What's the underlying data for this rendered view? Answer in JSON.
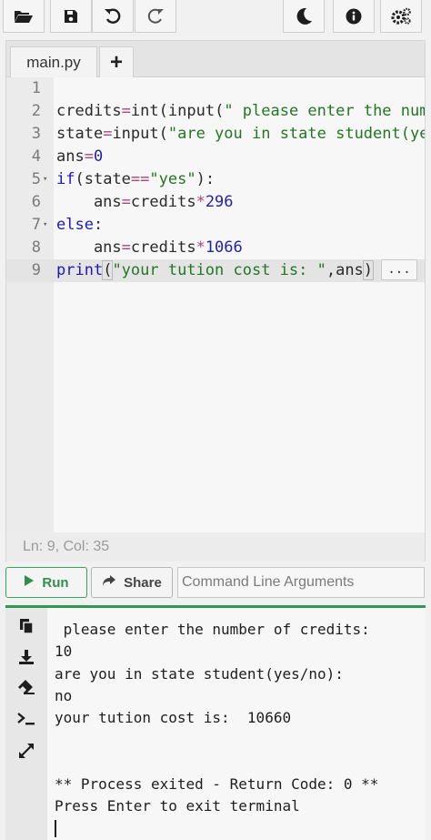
{
  "editor": {
    "tab_label": "main.py",
    "add_tab_label": "+",
    "lines": [
      {
        "n": "1",
        "tokens": []
      },
      {
        "n": "2",
        "tokens": [
          {
            "t": "credits",
            "c": "plain"
          },
          {
            "t": "=",
            "c": "op"
          },
          {
            "t": "int",
            "c": "plain"
          },
          {
            "t": "(",
            "c": "plain"
          },
          {
            "t": "input",
            "c": "plain"
          },
          {
            "t": "(",
            "c": "plain"
          },
          {
            "t": "\" please enter the num",
            "c": "str"
          }
        ]
      },
      {
        "n": "3",
        "tokens": [
          {
            "t": "state",
            "c": "plain"
          },
          {
            "t": "=",
            "c": "op"
          },
          {
            "t": "input",
            "c": "plain"
          },
          {
            "t": "(",
            "c": "plain"
          },
          {
            "t": "\"are you in state student(ye",
            "c": "str"
          }
        ]
      },
      {
        "n": "4",
        "tokens": [
          {
            "t": "ans",
            "c": "plain"
          },
          {
            "t": "=",
            "c": "op"
          },
          {
            "t": "0",
            "c": "num"
          }
        ]
      },
      {
        "n": "5",
        "fold": true,
        "tokens": [
          {
            "t": "if",
            "c": "kw"
          },
          {
            "t": "(",
            "c": "plain"
          },
          {
            "t": "state",
            "c": "plain"
          },
          {
            "t": "==",
            "c": "op"
          },
          {
            "t": "\"yes\"",
            "c": "str"
          },
          {
            "t": "):",
            "c": "plain"
          }
        ]
      },
      {
        "n": "6",
        "tokens": [
          {
            "t": "    ans",
            "c": "plain"
          },
          {
            "t": "=",
            "c": "op"
          },
          {
            "t": "credits",
            "c": "plain"
          },
          {
            "t": "*",
            "c": "op"
          },
          {
            "t": "296",
            "c": "num"
          }
        ]
      },
      {
        "n": "7",
        "fold": true,
        "tokens": [
          {
            "t": "else",
            "c": "kw"
          },
          {
            "t": ":",
            "c": "plain"
          }
        ]
      },
      {
        "n": "8",
        "tokens": [
          {
            "t": "    ans",
            "c": "plain"
          },
          {
            "t": "=",
            "c": "op"
          },
          {
            "t": "credits",
            "c": "plain"
          },
          {
            "t": "*",
            "c": "op"
          },
          {
            "t": "1066",
            "c": "num"
          }
        ]
      },
      {
        "n": "9",
        "active": true,
        "tokens": [
          {
            "t": "print",
            "c": "kw"
          },
          {
            "t": "(",
            "c": "bracket"
          },
          {
            "t": "\"your tution cost is: \"",
            "c": "str"
          },
          {
            "t": ",ans",
            "c": "plain"
          },
          {
            "t": ")",
            "c": "bracket"
          }
        ]
      }
    ],
    "ellipsis": "...",
    "status": "Ln: 9,  Col: 35"
  },
  "actions": {
    "run_label": "Run",
    "share_label": "Share",
    "args_placeholder": "Command Line Arguments",
    "args_value": ""
  },
  "terminal": {
    "lines": [
      " please enter the number of credits:",
      "10",
      "are you in state student(yes/no):",
      "no",
      "your tution cost is:  10660",
      "",
      "",
      "** Process exited - Return Code: 0 **",
      "Press Enter to exit terminal"
    ]
  },
  "colors": {
    "accent_green": "#2f9a4f",
    "keyword_blue": "#1b1bb4",
    "string_green": "#227722",
    "operator_pink": "#a7477c"
  },
  "icons": {
    "toolbar": [
      "folder-open-icon",
      "save-icon",
      "undo-icon",
      "redo-icon",
      "moon-icon",
      "info-icon",
      "settings-icon"
    ],
    "terminal_side": [
      "copy-icon",
      "download-icon",
      "eraser-icon",
      "terminal-prompt-icon",
      "expand-icon"
    ]
  }
}
